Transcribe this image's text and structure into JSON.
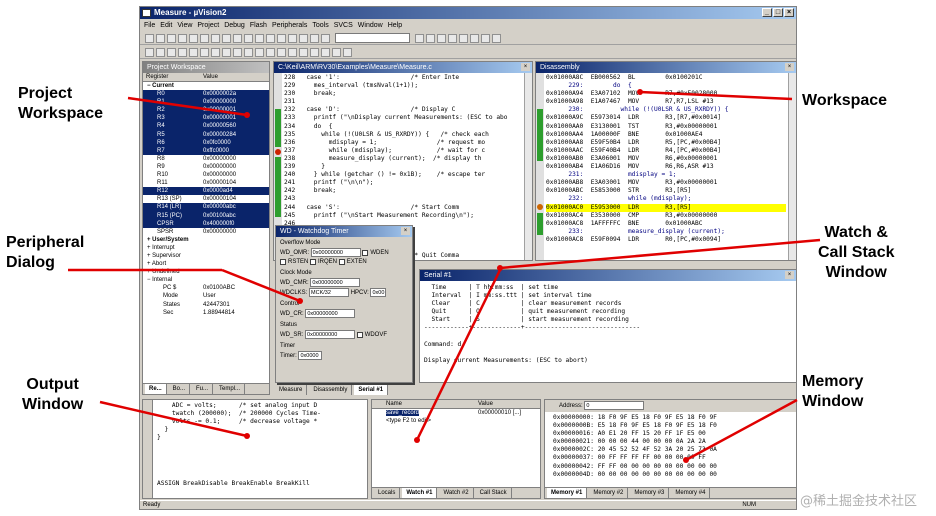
{
  "app": {
    "title": "Measure - µVision2",
    "menu": [
      "File",
      "Edit",
      "View",
      "Project",
      "Debug",
      "Flash",
      "Peripherals",
      "Tools",
      "SVCS",
      "Window",
      "Help"
    ],
    "status": "Ready",
    "status_right": "NUM"
  },
  "labels": {
    "project_workspace": "Project\nWorkspace",
    "workspace": "Workspace",
    "peripheral_dialog": "Peripheral\nDialog",
    "watch_callstack": "Watch &\nCall Stack\nWindow",
    "output_window": "Output\nWindow",
    "memory_window": "Memory\nWindow"
  },
  "project": {
    "title": "Project Workspace",
    "col_register": "Register",
    "col_value": "Value",
    "group_current": "Current",
    "registers": [
      {
        "name": "R0",
        "value": "0x0000002a",
        "sel": true
      },
      {
        "name": "R1",
        "value": "0x00000000",
        "sel": true
      },
      {
        "name": "R2",
        "value": "0x00000001",
        "sel": true
      },
      {
        "name": "R3",
        "value": "0x00000001",
        "sel": true
      },
      {
        "name": "R4",
        "value": "0x00000560",
        "sel": true
      },
      {
        "name": "R5",
        "value": "0x00000284",
        "sel": true
      },
      {
        "name": "R6",
        "value": "0x0fc0000",
        "sel": true
      },
      {
        "name": "R7",
        "value": "0xffc0000",
        "sel": true
      },
      {
        "name": "R8",
        "value": "0x00000000",
        "sel": false
      },
      {
        "name": "R9",
        "value": "0x00000000",
        "sel": false
      },
      {
        "name": "R10",
        "value": "0x00000000",
        "sel": false
      },
      {
        "name": "R11",
        "value": "0x00000104",
        "sel": false
      },
      {
        "name": "R12",
        "value": "0x0000ad4",
        "sel": true
      },
      {
        "name": "R13 (SP)",
        "value": "0x00000104",
        "sel": false
      },
      {
        "name": "R14 (LR)",
        "value": "0x00000abc",
        "sel": true
      },
      {
        "name": "R15 (PC)",
        "value": "0x00100abc",
        "sel": true
      },
      {
        "name": "CPSR",
        "value": "0x400000f0",
        "sel": true
      },
      {
        "name": "SPSR",
        "value": "0x00000000",
        "sel": false
      }
    ],
    "group_user": "User/System",
    "modes": [
      "Interrupt",
      "Supervisor",
      "Abort",
      "Undefined",
      "Internal"
    ],
    "internal": [
      {
        "name": "PC $",
        "value": "0x0100ABC"
      },
      {
        "name": "Mode",
        "value": "User"
      },
      {
        "name": "States",
        "value": "42447301"
      },
      {
        "name": "Sec",
        "value": "1.88944814"
      }
    ]
  },
  "source": {
    "title": "C:\\Keil\\ARM\\RV30\\Examples\\Measure\\Measure.c",
    "lines": [
      "228   case '1':                   /* Enter Inte",
      "229     mes_interval (tmsNval(1+1));",
      "230     break;",
      "231",
      "232   case 'D':                   /* Display C",
      "233     printf (\"\\nDisplay current Measurements: (ESC to abo",
      "234     do  {",
      "235       while (!(U0LSR & US_RXRDY)) {   /* check each",
      "236         mdisplay = 1;                /* request mo",
      "237         while (mdisplay);            /* wait for c",
      "238         measure_display (current);  /* display th",
      "239       }",
      "240     } while (getchar () != 0x1B);    /* escape ter",
      "241     printf (\"\\n\\n\");",
      "242     break;",
      "243",
      "244   case 'S':                   /* Start Comm",
      "245     printf (\"\\nStart Measurement Recording\\n\");",
      "246",
      "247",
      "248",
      "249",
      "250                               /* Quit Comma"
    ]
  },
  "disasm": {
    "title": "Disassembly",
    "lines": [
      {
        "t": "0x01000A8C  EB000562  BL        0x0100201C",
        "hl": false
      },
      {
        "t": "      229:        do  {",
        "hl": false
      },
      {
        "t": "0x01000A94  E3A07102  MOV       R7,#0xE0028000",
        "hl": false
      },
      {
        "t": "0x01000A98  E1A07467  MOV       R7,R7,LSL #13",
        "hl": false
      },
      {
        "t": "      230:          while (!(U0LSR & US_RXRDY)) {",
        "hl": false
      },
      {
        "t": "0x01000A9C  E5973014  LDR       R3,[R7,#0x0014]",
        "hl": false
      },
      {
        "t": "0x01000AA0  E3130001  TST       R3,#0x00000001",
        "hl": false
      },
      {
        "t": "0x01000AA4  1A00000F  BNE       0x01000AE4",
        "hl": false
      },
      {
        "t": "0x01000AA8  E59F50B4  LDR       R5,[PC,#0x00B4]",
        "hl": false
      },
      {
        "t": "0x01000AAC  E59F40B4  LDR       R4,[PC,#0x00B4]",
        "hl": false
      },
      {
        "t": "0x01000AB0  E3A06001  MOV       R6,#0x00000001",
        "hl": false
      },
      {
        "t": "0x01000AB4  E1A06D16  MOV       R6,R6,ASR #13",
        "hl": false
      },
      {
        "t": "      231:            mdisplay = 1;",
        "hl": false
      },
      {
        "t": "0x01000AB8  E3A03001  MOV       R3,#0x00000001",
        "hl": false
      },
      {
        "t": "0x01000ABC  E5853000  STR       R3,[R5]",
        "hl": false
      },
      {
        "t": "      232:            while (mdisplay);",
        "hl": false
      },
      {
        "t": "0x01000AC0  E5953000  LDR       R3,[R5]",
        "hl": true
      },
      {
        "t": "0x01000AC4  E3530000  CMP       R3,#0x00000000",
        "hl": false
      },
      {
        "t": "0x01000AC8  1AFFFFFC  BNE       0x01000ABC",
        "hl": false
      },
      {
        "t": "      233:            measure_display (current);",
        "hl": false
      },
      {
        "t": "0x01000AC8  E59F0094  LDR       R0,[PC,#0x0094]",
        "hl": false
      }
    ]
  },
  "wdt": {
    "title": "WD - Watchdog Timer",
    "overflow_mode": "Overflow Mode",
    "wd_omr_label": "WD_OMR:",
    "wd_omr": "0x00000000",
    "wden": "WDEN",
    "rsten": "RSTEN",
    "irqen": "IRQEN",
    "exten": "EXTEN",
    "clock_mode": "Clock Mode",
    "wd_cmr_label": "WD_CMR:",
    "wd_cmr": "0x00000000",
    "wdclks_label": "WDCLKS:",
    "wdclks": "MCK/32",
    "hpcv_label": "HPCV:",
    "hpcv": "0x00",
    "control": "Control",
    "wd_cr_label": "WD_CR:",
    "wd_cr": "0x00000000",
    "status": "Status",
    "wd_sr_label": "WD_SR:",
    "wd_sr": "0x00000000",
    "wdovf": "WDOVF",
    "timer": "Timer",
    "timer_label": "Timer:",
    "timer_val": "0x0000"
  },
  "serial": {
    "title": "Serial #1",
    "lines": [
      "  Time      | T hh:mm:ss  | set time",
      "  Interval  | I mm:ss.ttt | set interval time",
      "  Clear     | C           | clear measurement records",
      "  Quit      | Q           | quit measurement recording",
      "  Start     | S           | start measurement recording",
      "------------+-------------+-------------------------------",
      "",
      "Command: d",
      "",
      "Display current Measurements: (ESC to abort)"
    ]
  },
  "mid_tabs": [
    "Measure",
    "Disassembly",
    "Serial #1"
  ],
  "output": {
    "lines": [
      "    ADC = volts;      /* set analog input D",
      "    twatch (200000);  /* 200000 Cycles Time-",
      "    volts -= 0.1;     /* decrease voltage *",
      "  }",
      "}"
    ],
    "cmdline": "ASSIGN BreakDisable BreakEnable BreakKill"
  },
  "watch": {
    "col_name": "Name",
    "col_value": "Value",
    "rows": [
      {
        "name": "save_record",
        "value": "0x00000010 [...]",
        "sel": true
      },
      {
        "name": "<type F2 to edit>",
        "value": "",
        "sel": false
      }
    ],
    "tabs": [
      "Locals",
      "Watch #1",
      "Watch #2",
      "Call Stack"
    ]
  },
  "memory": {
    "address_label": "Address:",
    "address": "0",
    "lines": [
      "0x00000000: 18 F0 9F E5 18 F0 9F E5 18 F0 9F",
      "0x0000000B: E5 18 F0 9F E5 18 F0 9F E5 18 F0",
      "0x00000016: A0 E1 20 FF 15 20 FF 1F E5 00",
      "0x00000021: 00 00 00 44 00 00 00 0A 2A 2A",
      "0x0000002C: 20 45 52 52 4F 52 3A 20 25 73 0A",
      "0x00000037: 00 FF FF FF FF 00 00 00 00 FF",
      "0x00000042: FF FF 00 00 00 00 00 00 00 00 00",
      "0x0000004D: 00 00 00 00 00 00 00 00 00 00 00"
    ],
    "tabs": [
      "Memory #1",
      "Memory #2",
      "Memory #3",
      "Memory #4"
    ]
  },
  "left_tabs": [
    "Re...",
    "Bo...",
    "Fu...",
    "Templ..."
  ],
  "watermark": "@稀土掘金技术社区"
}
